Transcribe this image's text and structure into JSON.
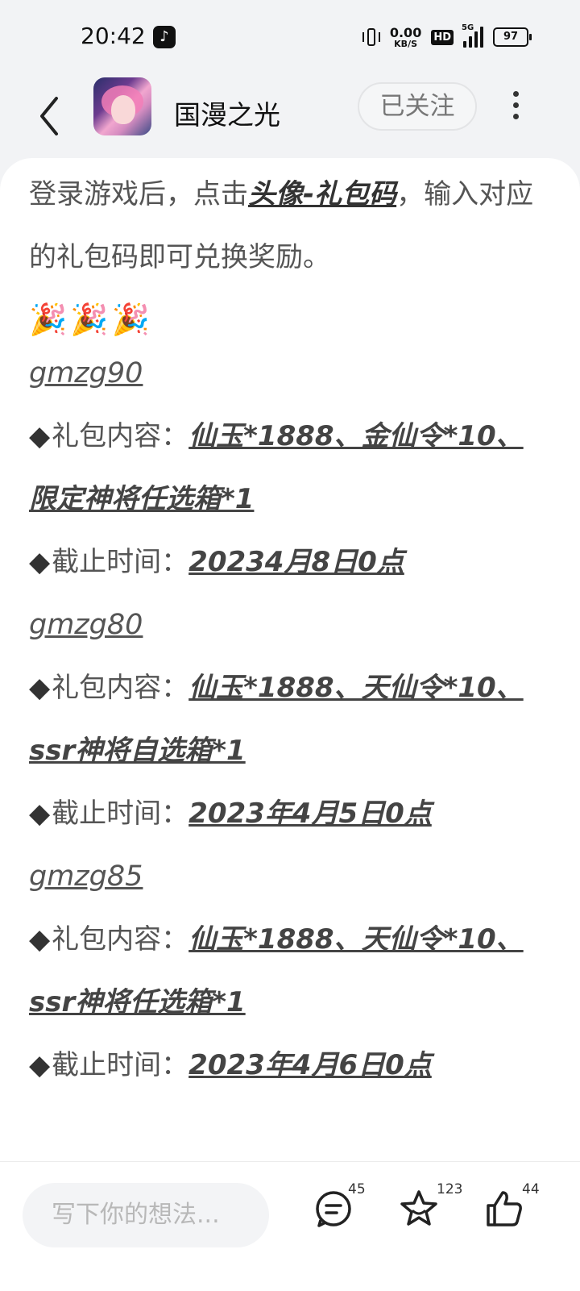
{
  "status_bar": {
    "time": "20:42",
    "net_speed_value": "0.00",
    "net_speed_unit": "KB/S",
    "hd": "HD",
    "network": "5G",
    "battery": "97"
  },
  "header": {
    "channel_name": "国漫之光",
    "follow_label": "已关注"
  },
  "article": {
    "intro_prefix": "登录游戏后，点击",
    "intro_link": "头像-礼包码",
    "intro_suffix": "，输入对应的礼包码即可兑换奖励。",
    "emojis": "🎉🎉🎉",
    "codes": [
      {
        "code": "gmzg90",
        "content_label": "礼包内容：",
        "content_value": "仙玉*1888、金仙令*10、限定神将任选箱*1",
        "deadline_label": "截止时间：",
        "deadline_value": "20234月8日0点"
      },
      {
        "code": "gmzg80",
        "content_label": "礼包内容：",
        "content_value": "仙玉*1888、天仙令*10、ssr神将自选箱*1",
        "deadline_label": "截止时间：",
        "deadline_value": "2023年4月5日0点"
      },
      {
        "code": "gmzg85",
        "content_label": "礼包内容：",
        "content_value": "仙玉*1888、天仙令*10、ssr神将任选箱*1",
        "deadline_label": "截止时间：",
        "deadline_value": "2023年4月6日0点"
      }
    ]
  },
  "bottom_bar": {
    "comment_placeholder": "写下你的想法...",
    "comment_count": "45",
    "favorite_count": "123",
    "like_count": "44"
  }
}
